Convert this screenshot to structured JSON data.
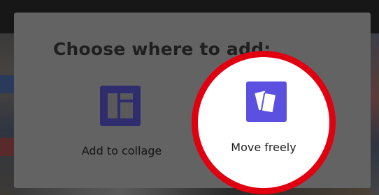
{
  "dialog": {
    "title": "Choose where to add:",
    "options": [
      {
        "label": "Add to collage",
        "icon": "collage-layout-icon"
      },
      {
        "label": "Move freely",
        "icon": "move-freely-icon",
        "highlighted": true
      }
    ]
  },
  "colors": {
    "dialog_background": "#636363",
    "collage_icon": "#2f2d6e",
    "move_icon": "#5b50e0",
    "highlight_ring": "#e0000f"
  }
}
